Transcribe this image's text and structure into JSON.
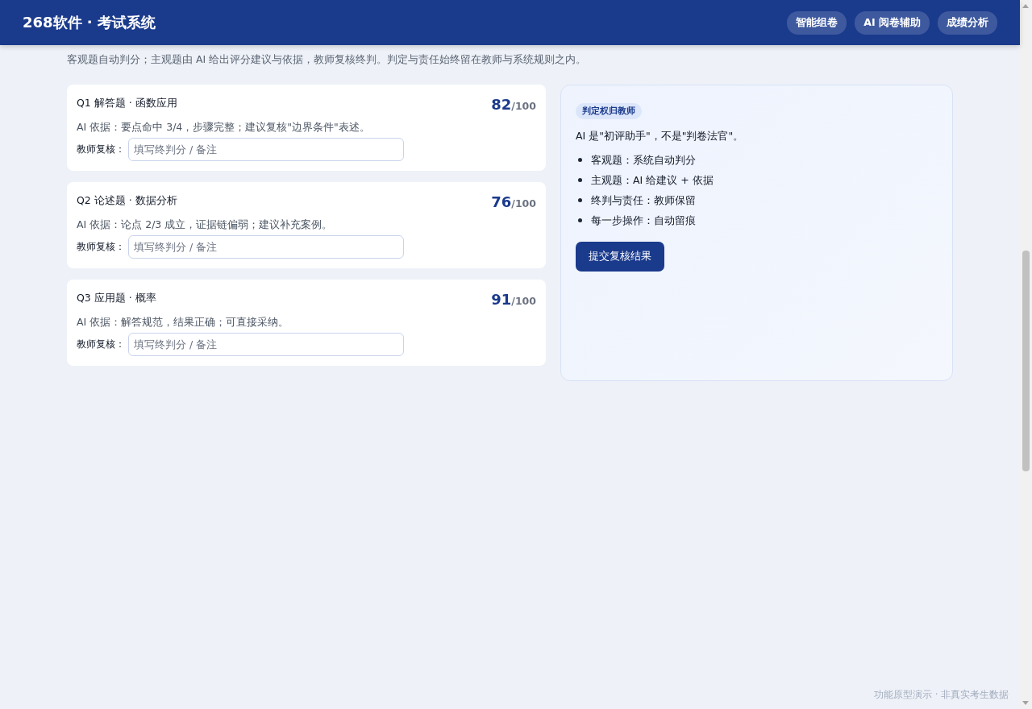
{
  "header": {
    "title": "268软件 · 考试系统",
    "nav": [
      {
        "label": "智能组卷"
      },
      {
        "label": "AI 阅卷辅助"
      },
      {
        "label": "成绩分析"
      }
    ]
  },
  "intro": "客观题自动判分；主观题由 AI 给出评分建议与依据，教师复核终判。判定与责任始终留在教师与系统规则之内。",
  "questions": [
    {
      "title": "Q1 解答题 · 函数应用",
      "score": "82",
      "total": "/100",
      "basis": "AI 依据：要点命中 3/4，步骤完整；建议复核\"边界条件\"表述。",
      "review_label": "教师复核：",
      "placeholder": "填写终判分 / 备注"
    },
    {
      "title": "Q2 论述题 · 数据分析",
      "score": "76",
      "total": "/100",
      "basis": "AI 依据：论点 2/3 成立，证据链偏弱；建议补充案例。",
      "review_label": "教师复核：",
      "placeholder": "填写终判分 / 备注"
    },
    {
      "title": "Q3 应用题 · 概率",
      "score": "91",
      "total": "/100",
      "basis": "AI 依据：解答规范，结果正确；可直接采纳。",
      "review_label": "教师复核：",
      "placeholder": "填写终判分 / 备注"
    }
  ],
  "panel": {
    "badge": "判定权归教师",
    "lead": "AI 是\"初评助手\"，不是\"判卷法官\"。",
    "points": [
      "客观题：系统自动判分",
      "主观题：AI 给建议 + 依据",
      "终判与责任：教师保留",
      "每一步操作：自动留痕"
    ],
    "button": "提交复核结果"
  },
  "footer": "功能原型演示 · 非真实考生数据"
}
